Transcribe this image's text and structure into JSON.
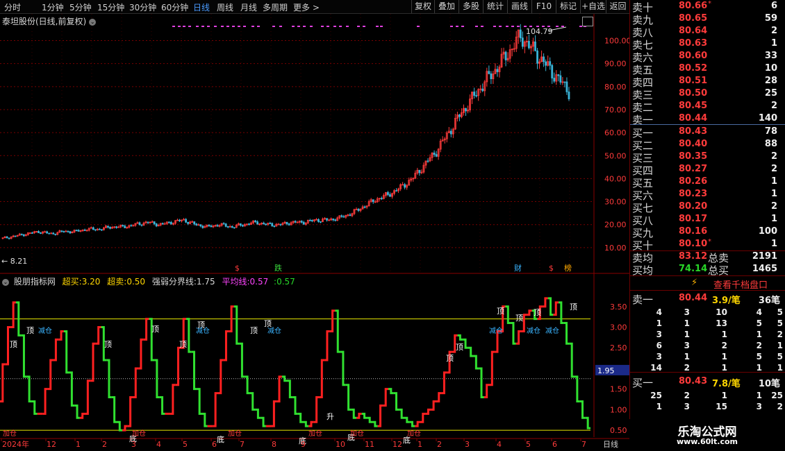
{
  "toolbar": {
    "periods": [
      "分时",
      "1分钟",
      "5分钟",
      "15分钟",
      "30分钟",
      "60分钟",
      "日线",
      "周线",
      "月线",
      "多周期",
      "更多 >"
    ],
    "active_period": "日线",
    "buttons": [
      "复权",
      "叠加",
      "多股",
      "统计",
      "画线",
      "F10",
      "标记",
      "+自选",
      "返回"
    ]
  },
  "main_chart": {
    "title": "泰坦股份(日线,前复权)",
    "high_label": "104.79",
    "low_label": "← 8.21",
    "price_axis": [
      "100.00",
      "90.00",
      "80.00",
      "70.00",
      "60.00",
      "50.00",
      "40.00",
      "30.00",
      "20.00",
      "10.00"
    ],
    "event_markers": [
      "$",
      "跌",
      "财",
      "$",
      "榜"
    ]
  },
  "indicator": {
    "name": "股朋指标网",
    "buy_label": "超买:",
    "buy_val": "3.20",
    "sell_label": "超卖:",
    "sell_val": "0.50",
    "mid_label": "强弱分界线:",
    "mid_val": "1.75",
    "avg_label": "平均线:",
    "avg_val": "0.57",
    "last_label": ":",
    "last_val": "0.57",
    "axis": [
      "3.50",
      "3.00",
      "2.50",
      "2.00",
      "1.50",
      "1.00",
      "0.50"
    ],
    "current_value": "1.95",
    "signals": {
      "top": "顶",
      "bottom": "底",
      "rise": "升",
      "reduce": "减仓",
      "add": "加仓"
    }
  },
  "x_axis": {
    "labels": [
      "2024年",
      "12",
      "1",
      "2",
      "3",
      "4",
      "5",
      "6",
      "7",
      "8",
      "9",
      "10",
      "11",
      "12",
      "1",
      "2",
      "3",
      "4",
      "5",
      "6",
      "7"
    ],
    "period_tag": "日线"
  },
  "chart_data": {
    "type": "candlestick",
    "title": "泰坦股份(日线,前复权)",
    "ylim": [
      0,
      108
    ],
    "ticks": [
      10,
      20,
      30,
      40,
      50,
      60,
      70,
      80,
      90,
      100
    ],
    "high": 104.79,
    "low": 8.21,
    "trend_close": [
      14,
      15,
      16,
      17,
      16,
      17,
      17,
      18,
      18,
      19,
      19,
      20,
      21,
      20,
      21,
      22,
      20,
      19,
      20,
      19,
      20,
      21,
      20,
      20,
      21,
      21,
      22,
      22,
      23,
      25,
      28,
      31,
      33,
      36,
      40,
      46,
      52,
      60,
      68,
      75,
      82,
      88,
      95,
      102,
      96,
      90,
      84,
      78
    ],
    "indicator": {
      "ylim": [
        0.3,
        3.9
      ],
      "overbought": 3.2,
      "oversold": 0.5,
      "midline": 1.75,
      "values": [
        1.2,
        2.1,
        3.0,
        3.6,
        2.8,
        1.8,
        1.2,
        0.9,
        0.9,
        1.5,
        2.2,
        2.7,
        2.9,
        1.9,
        1.1,
        0.8,
        0.9,
        1.7,
        2.6,
        3.0,
        2.2,
        1.3,
        0.7,
        0.5,
        0.6,
        1.3,
        2.0,
        2.7,
        3.2,
        2.2,
        1.3,
        0.9,
        0.9,
        1.6,
        2.5,
        3.2,
        2.4,
        1.5,
        0.9,
        0.6,
        0.6,
        1.4,
        2.2,
        2.9,
        3.5,
        2.6,
        1.8,
        1.4,
        1.0,
        0.8,
        0.6,
        0.6,
        1.2,
        1.8,
        1.7,
        1.3,
        0.9,
        0.7,
        0.6,
        0.7,
        1.3,
        2.2,
        2.9,
        3.4,
        2.4,
        1.6,
        1.0,
        0.8,
        0.9,
        0.8,
        0.7,
        0.6,
        1.1,
        1.5,
        1.4,
        1.0,
        0.8,
        0.7,
        0.6,
        0.7,
        0.9,
        1.0,
        1.2,
        1.4,
        1.9,
        2.4,
        2.8,
        2.7,
        2.5,
        2.3,
        2.0,
        1.3,
        1.6,
        2.4,
        2.9,
        3.5,
        3.1,
        2.6,
        2.9,
        3.3,
        3.4,
        3.2,
        3.5,
        3.7,
        3.3,
        3.6,
        3.1,
        2.6,
        1.8,
        1.2,
        0.8,
        0.55
      ]
    }
  },
  "order_book": {
    "sells": [
      {
        "label": "卖十",
        "price": "80.66",
        "vol": "6",
        "mark": "*"
      },
      {
        "label": "卖九",
        "price": "80.65",
        "vol": "59"
      },
      {
        "label": "卖八",
        "price": "80.64",
        "vol": "2"
      },
      {
        "label": "卖七",
        "price": "80.63",
        "vol": "1"
      },
      {
        "label": "卖六",
        "price": "80.60",
        "vol": "33"
      },
      {
        "label": "卖五",
        "price": "80.52",
        "vol": "10"
      },
      {
        "label": "卖四",
        "price": "80.51",
        "vol": "28"
      },
      {
        "label": "卖三",
        "price": "80.50",
        "vol": "25"
      },
      {
        "label": "卖二",
        "price": "80.45",
        "vol": "2"
      },
      {
        "label": "卖一",
        "price": "80.44",
        "vol": "140"
      }
    ],
    "buys": [
      {
        "label": "买一",
        "price": "80.43",
        "vol": "78"
      },
      {
        "label": "买二",
        "price": "80.40",
        "vol": "88"
      },
      {
        "label": "买三",
        "price": "80.35",
        "vol": "2"
      },
      {
        "label": "买四",
        "price": "80.27",
        "vol": "2"
      },
      {
        "label": "买五",
        "price": "80.26",
        "vol": "1"
      },
      {
        "label": "买六",
        "price": "80.23",
        "vol": "1"
      },
      {
        "label": "买七",
        "price": "80.20",
        "vol": "2"
      },
      {
        "label": "买八",
        "price": "80.17",
        "vol": "1"
      },
      {
        "label": "买九",
        "price": "80.16",
        "vol": "100"
      },
      {
        "label": "买十",
        "price": "80.10",
        "vol": "1",
        "mark": "*"
      }
    ],
    "sell_avg": {
      "label": "卖均",
      "price": "83.12",
      "tlabel": "总卖",
      "vol": "2191"
    },
    "buy_avg": {
      "label": "买均",
      "price": "74.14",
      "tlabel": "总买",
      "vol": "1465"
    },
    "thousand_btn": "查看千档盘口",
    "queue_sell": {
      "label": "卖一",
      "price": "80.44",
      "per": "3.9/笔",
      "count": "36笔",
      "rows": [
        [
          "4",
          "3",
          "10",
          "4",
          "5"
        ],
        [
          "1",
          "1",
          "13",
          "5",
          "5"
        ],
        [
          "3",
          "1",
          "1",
          "1",
          "2"
        ],
        [
          "6",
          "3",
          "2",
          "2",
          "1"
        ],
        [
          "3",
          "1",
          "1",
          "5",
          "5"
        ],
        [
          "14",
          "2",
          "1",
          "1",
          "1"
        ]
      ]
    },
    "queue_buy": {
      "label": "买一",
      "price": "80.43",
      "per": "7.8/笔",
      "count": "10笔",
      "rows": [
        [
          "25",
          "2",
          "1",
          "1",
          "25"
        ],
        [
          "1",
          "3",
          "15",
          "3",
          "2"
        ]
      ]
    }
  },
  "brand": {
    "name": "乐淘公式网",
    "url": "www.60lt.com"
  }
}
